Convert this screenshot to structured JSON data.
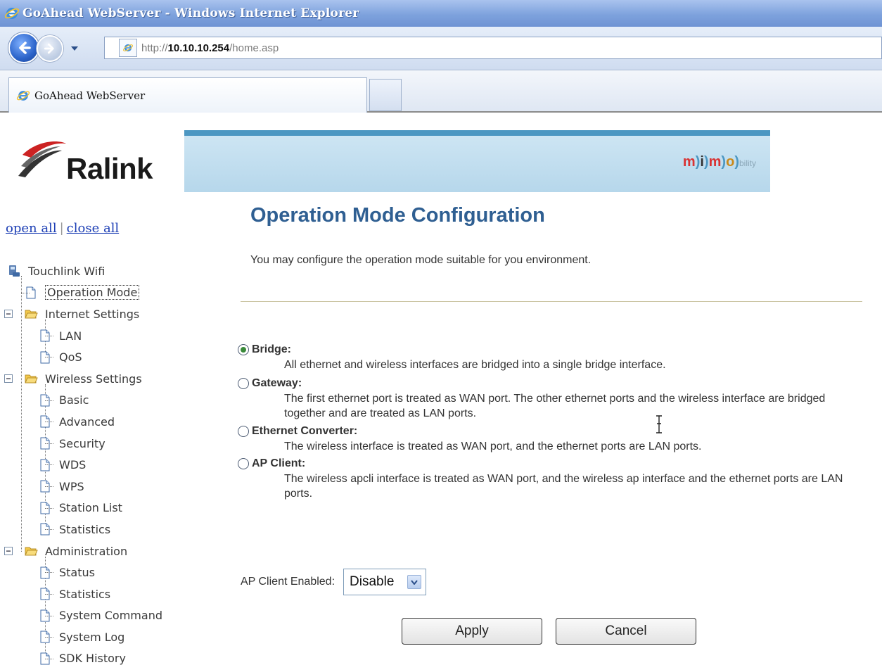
{
  "window": {
    "title": "GoAhead WebServer - Windows Internet Explorer"
  },
  "address_bar": {
    "url_prefix": "http://",
    "url_host": "10.10.10.254",
    "url_path": "/home.asp"
  },
  "tabs": [
    {
      "label": "GoAhead WebServer",
      "active": true
    }
  ],
  "header": {
    "logo_text": "Ralink",
    "banner_tagline": {
      "m": "m",
      "i": "i",
      "m2": "m",
      "o": "o",
      "rest": "bility"
    }
  },
  "sidebar": {
    "open_all": "open all",
    "separator": "|",
    "close_all": "close all",
    "root": "Touchlink Wifi",
    "items": [
      {
        "label": "Operation Mode",
        "level": 1,
        "type": "page",
        "selected": true
      },
      {
        "label": "Internet Settings",
        "level": 1,
        "type": "folder"
      },
      {
        "label": "LAN",
        "level": 2,
        "type": "page"
      },
      {
        "label": "QoS",
        "level": 2,
        "type": "page"
      },
      {
        "label": "Wireless Settings",
        "level": 1,
        "type": "folder"
      },
      {
        "label": "Basic",
        "level": 2,
        "type": "page"
      },
      {
        "label": "Advanced",
        "level": 2,
        "type": "page"
      },
      {
        "label": "Security",
        "level": 2,
        "type": "page"
      },
      {
        "label": "WDS",
        "level": 2,
        "type": "page"
      },
      {
        "label": "WPS",
        "level": 2,
        "type": "page"
      },
      {
        "label": "Station List",
        "level": 2,
        "type": "page"
      },
      {
        "label": "Statistics",
        "level": 2,
        "type": "page"
      },
      {
        "label": "Administration",
        "level": 1,
        "type": "folder"
      },
      {
        "label": "Status",
        "level": 2,
        "type": "page"
      },
      {
        "label": "Statistics",
        "level": 2,
        "type": "page"
      },
      {
        "label": "System Command",
        "level": 2,
        "type": "page"
      },
      {
        "label": "System Log",
        "level": 2,
        "type": "page"
      },
      {
        "label": "SDK History",
        "level": 2,
        "type": "page"
      }
    ]
  },
  "main": {
    "title": "Operation Mode Configuration",
    "intro": "You may configure the operation mode suitable for you environment.",
    "modes": [
      {
        "name": "Bridge:",
        "checked": true,
        "desc": "All ethernet and wireless interfaces are bridged into a single bridge interface."
      },
      {
        "name": "Gateway:",
        "checked": false,
        "desc": "The first ethernet port is treated as WAN port. The other ethernet ports and the wireless interface are bridged together and are treated as LAN ports."
      },
      {
        "name": "Ethernet Converter:",
        "checked": false,
        "desc": "The wireless interface is treated as WAN port, and the ethernet ports are LAN ports."
      },
      {
        "name": "AP Client:",
        "checked": false,
        "desc": "The wireless apcli interface is treated as WAN port, and the wireless ap interface and the ethernet ports are LAN ports."
      }
    ],
    "ap_client_label": "AP Client Enabled:",
    "ap_client_value": "Disable",
    "apply_label": "Apply",
    "cancel_label": "Cancel"
  },
  "colors": {
    "title_blue": "#2f5f92",
    "link_blue": "#1d3fb5",
    "banner_bar": "#4c97c2"
  }
}
